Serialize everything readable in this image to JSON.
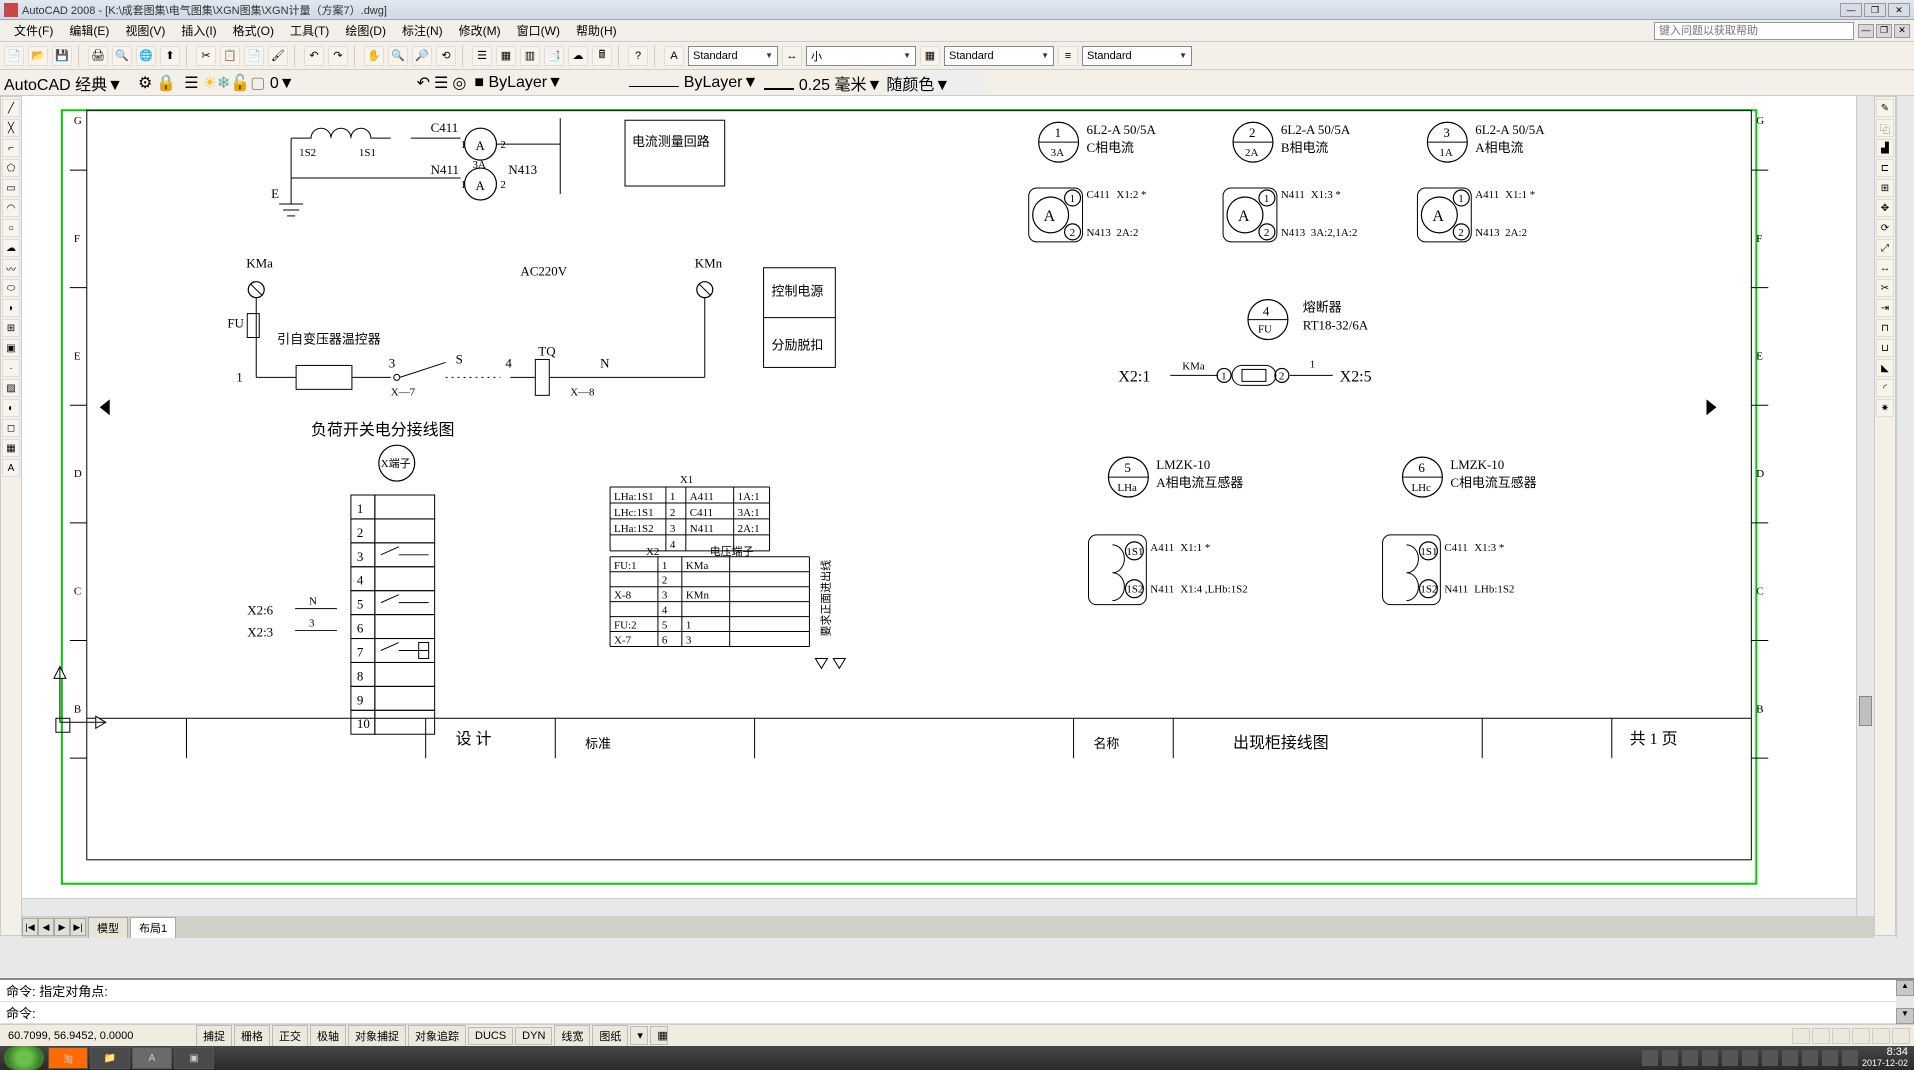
{
  "app": {
    "name": "AutoCAD 2008",
    "doc_path": "[K:\\成套图集\\电气图集\\XGN图集\\XGN计量（方案7）.dwg]"
  },
  "window_controls": {
    "min": "—",
    "restore": "❐",
    "close": "✕"
  },
  "menu": {
    "file": "文件(F)",
    "edit": "编辑(E)",
    "view": "视图(V)",
    "insert": "插入(I)",
    "format": "格式(O)",
    "tools": "工具(T)",
    "draw": "绘图(D)",
    "dimension": "标注(N)",
    "modify": "修改(M)",
    "window": "窗口(W)",
    "help": "帮助(H)",
    "helpbox_placeholder": "键入问题以获取帮助",
    "rb1": "—",
    "rb2": "❐",
    "rb3": "✕"
  },
  "toolbar1": {
    "workspace_combo": "AutoCAD 经典",
    "textstyle_combo": "Standard",
    "dimstyle_combo": "小",
    "tablestyle_combo": "Standard",
    "mlstyle_combo": "Standard"
  },
  "toolbar2": {
    "layer_combo": "0",
    "color_combo": "■ ByLayer",
    "linetype_combo": "ByLayer",
    "lineweight_combo": "0.25 毫米",
    "plotstyle_combo": "随颜色"
  },
  "tabs": {
    "nav_first": "|◀",
    "nav_prev": "◀",
    "nav_next": "▶",
    "nav_last": "▶|",
    "model": "模型",
    "layout1": "布局1"
  },
  "command": {
    "history": "命令: 指定对角点:",
    "prompt": "命令:"
  },
  "status": {
    "coords": "60.7099, 56.9452, 0.0000",
    "snap": "捕捉",
    "grid": "栅格",
    "ortho": "正交",
    "polar": "极轴",
    "osnap": "对象捕捉",
    "otrack": "对象追踪",
    "ducs": "DUCS",
    "dyn": "DYN",
    "lw": "线宽",
    "paper": "图纸"
  },
  "taskbar": {
    "clock": "8:34",
    "date": "2017-12-02"
  },
  "cad": {
    "ruler_labels": [
      "G",
      "F",
      "E",
      "D",
      "C",
      "B"
    ],
    "text_C411": "C411",
    "text_1S2": "1S2",
    "text_1S1": "1S1",
    "text_3A": "3A",
    "text_N411": "N411",
    "text_N413": "N413",
    "text_A": "A",
    "text_E": "E",
    "text_1": "1",
    "text_2": "2",
    "text_current_loop": "电流测量回路",
    "c1_top": "1",
    "c1_bot": "3A",
    "c1_label_a": "6L2-A 50/5A",
    "c1_label_b": "C相电流",
    "c2_top": "2",
    "c2_bot": "2A",
    "c2_label_a": "6L2-A 50/5A",
    "c2_label_b": "B相电流",
    "c3_top": "3",
    "c3_bot": "1A",
    "c3_label_a": "6L2-A 50/5A",
    "c3_label_b": "A相电流",
    "sq1_a": "C411",
    "sq1_b": "X1:2 *",
    "sq1_c": "N413",
    "sq1_d": "2A:2",
    "sq2_a": "N411",
    "sq2_b": "X1:3 *",
    "sq2_c": "N413",
    "sq2_d": "3A:2,1A:2",
    "sq3_a": "A411",
    "sq3_b": "X1:1 *",
    "sq3_c": "N413",
    "sq3_d": "2A:2",
    "kma": "KMa",
    "kmn": "KMn",
    "ac220v": "AC220V",
    "fu_label": "FU",
    "from_transformer": "引自变压器温控器",
    "seg_1": "1",
    "seg_3": "3",
    "seg_S": "S",
    "seg_4": "4",
    "seg_TQ": "TQ",
    "seg_N": "N",
    "x7": "X—7",
    "x8": "X—8",
    "ctrl_power": "控制电源",
    "shunt_trip": "分励脱扣",
    "c4_top": "4",
    "c4_bot": "FU",
    "c4_label_a": "熔断器",
    "c4_label_b": "RT18-32/6A",
    "x21": "X2:1",
    "x25": "X2:5",
    "kma2": "KMa",
    "seg2_1": "1",
    "seg2_2": "2",
    "diagram_title": "负荷开关电分接线图",
    "xsym": "X端子",
    "tb_nums": [
      "1",
      "2",
      "3",
      "4",
      "5",
      "6",
      "7",
      "8",
      "9",
      "10"
    ],
    "x26": "X2:6",
    "x23": "X2:3",
    "seg_Nb": "N",
    "seg_3b": "3",
    "x1_hdr": "X1",
    "x1_rows": [
      [
        "LHa:1S1",
        "1",
        "A411",
        "1A:1"
      ],
      [
        "LHc:1S1",
        "2",
        "C411",
        "3A:1"
      ],
      [
        "LHa:1S2",
        "3",
        "N411",
        "2A:1"
      ],
      [
        "",
        "4",
        "",
        ""
      ]
    ],
    "x2_hdr": "X2",
    "x2_hdr2": "电压端子",
    "x2_rows": [
      [
        "FU:1",
        "1",
        "KMa",
        ""
      ],
      [
        "",
        "2",
        "",
        ""
      ],
      [
        "X-8",
        "3",
        "KMn",
        ""
      ],
      [
        "",
        "4",
        "",
        ""
      ],
      [
        "FU:2",
        "5",
        "1",
        ""
      ],
      [
        "X-7",
        "6",
        "3",
        ""
      ]
    ],
    "vtext": "要求正面进出线",
    "c5_top": "5",
    "c5_bot": "LHa",
    "c5_label_a": "LMZK-10",
    "c5_label_b": "A相电流互感器",
    "c6_top": "6",
    "c6_bot": "LHc",
    "c6_label_a": "LMZK-10",
    "c6_label_b": "C相电流互感器",
    "ct1_a": "A411",
    "ct1_b": "X1:1 *",
    "ct1_c": "N411",
    "ct1_d": "X1:4 ,LHb:1S2",
    "ct2_a": "C411",
    "ct2_b": "X1:3 *",
    "ct2_c": "N411",
    "ct2_d": "LHb:1S2",
    "ct_1s1": "1S1",
    "ct_1s2": "1S2",
    "tblk_design": "设 计",
    "tblk_pages": "共 1 页",
    "tblk_name": "名称",
    "tblk_title": "出现柜接线图",
    "tblk_std": "标准"
  }
}
